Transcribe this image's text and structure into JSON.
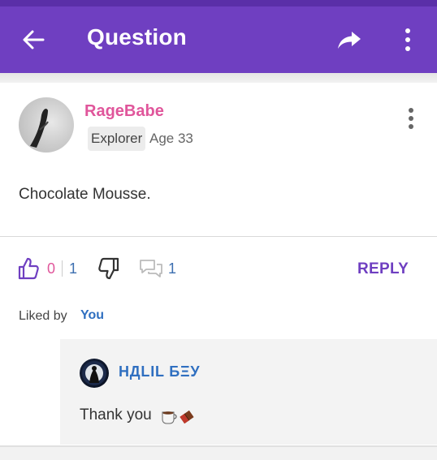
{
  "appbar": {
    "title": "Question",
    "back_icon": "arrow-left-icon",
    "share_icon": "share-arrow-icon",
    "more_icon": "more-vertical-icon",
    "background": "#6f3fc1"
  },
  "post": {
    "username": "RageBabe",
    "rank": "Explorer",
    "age": "Age 33",
    "content": "Chocolate Mousse.",
    "username_color": "#e0569b"
  },
  "actions": {
    "like_count": "0",
    "dislike_count": "1",
    "comment_count": "1",
    "reply_label": "REPLY"
  },
  "liked_by": {
    "label": "Liked by",
    "who": "You"
  },
  "reply": {
    "username": "НДLIL БΞУ",
    "text": "Thank you"
  }
}
